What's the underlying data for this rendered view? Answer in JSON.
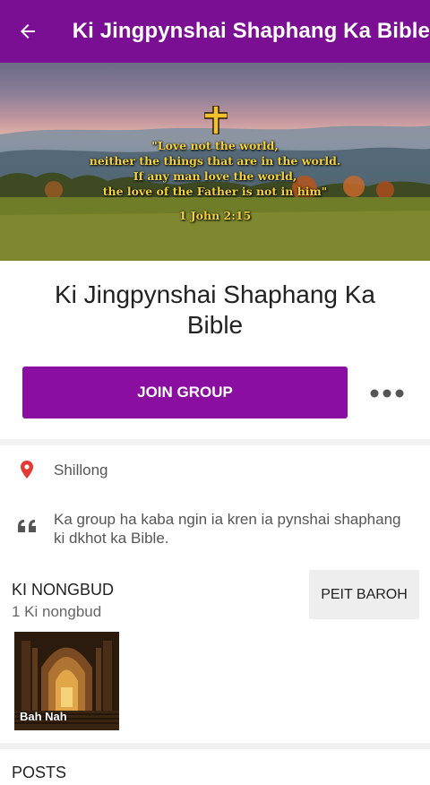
{
  "appbar": {
    "title": "Ki Jingpynshai Shaphang Ka Bible",
    "back_icon": "arrow-left-icon"
  },
  "cover": {
    "verse_lines": [
      "\"Love not the world,",
      "neither the things that are in the world.",
      "If any man love the world,",
      "the love of the Father is not in him\""
    ],
    "reference": "1 John 2:15",
    "cross_icon": "cross-icon"
  },
  "group": {
    "name_line1": "Ki Jingpynshai Shaphang Ka",
    "name_line2": "Bible",
    "join_label": "JOIN GROUP",
    "more_icon": "more-horizontal-icon"
  },
  "info": {
    "location": "Shillong",
    "location_icon": "map-pin-icon",
    "description_line1": "Ka group ha kaba ngin ia kren ia pynshai shaphang",
    "description_line2": "ki dkhot ka Bible.",
    "description_icon": "quote-icon"
  },
  "members": {
    "title": "KI NONGBUD",
    "count": "1 Ki nongbud",
    "see_all_label": "PEIT BAROH",
    "list": [
      {
        "name": "Bah Nah"
      }
    ]
  },
  "posts": {
    "title": "POSTS"
  },
  "colors": {
    "primary": "#7a0f93",
    "button": "#8a0fa0",
    "pin": "#e53935",
    "verse_text": "#f2d23c"
  }
}
